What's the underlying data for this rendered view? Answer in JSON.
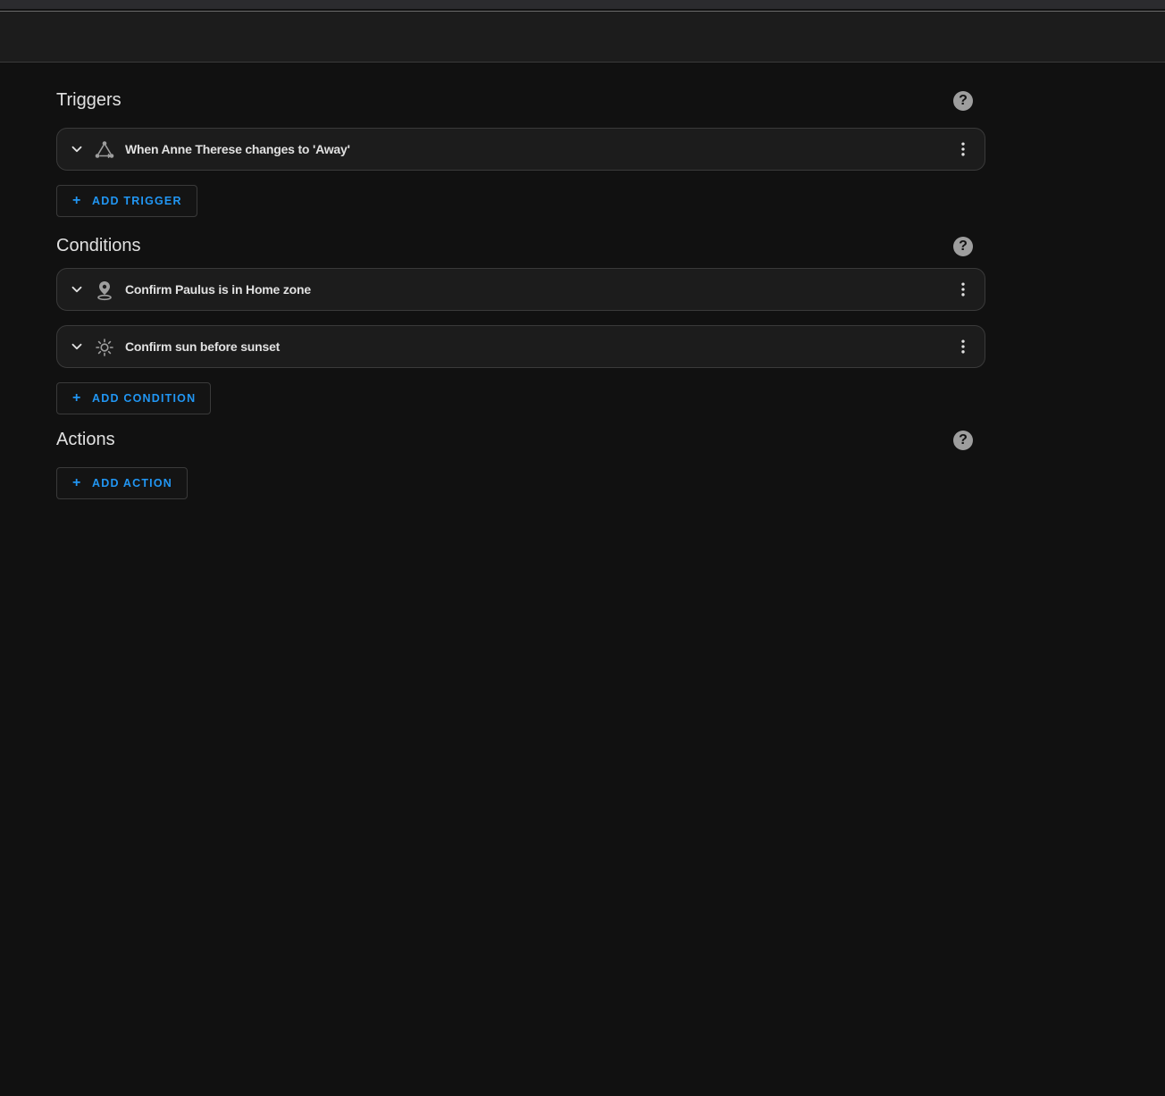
{
  "sections": {
    "triggers": {
      "title": "Triggers",
      "items": [
        {
          "label": "When Anne Therese changes to 'Away'",
          "icon": "state-trigger-icon"
        }
      ],
      "add_label": "ADD TRIGGER"
    },
    "conditions": {
      "title": "Conditions",
      "items": [
        {
          "label": "Confirm Paulus is in Home zone",
          "icon": "map-marker-icon"
        },
        {
          "label": "Confirm sun before sunset",
          "icon": "sun-icon"
        }
      ],
      "add_label": "ADD CONDITION"
    },
    "actions": {
      "title": "Actions",
      "items": [],
      "add_label": "ADD ACTION"
    }
  },
  "help_icon_text": "?",
  "plus_icon": "+",
  "colors": {
    "background": "#111111",
    "card": "#1c1c1c",
    "accent": "#2196f3",
    "text": "#e1e1e1",
    "icon": "#9e9e9e"
  }
}
